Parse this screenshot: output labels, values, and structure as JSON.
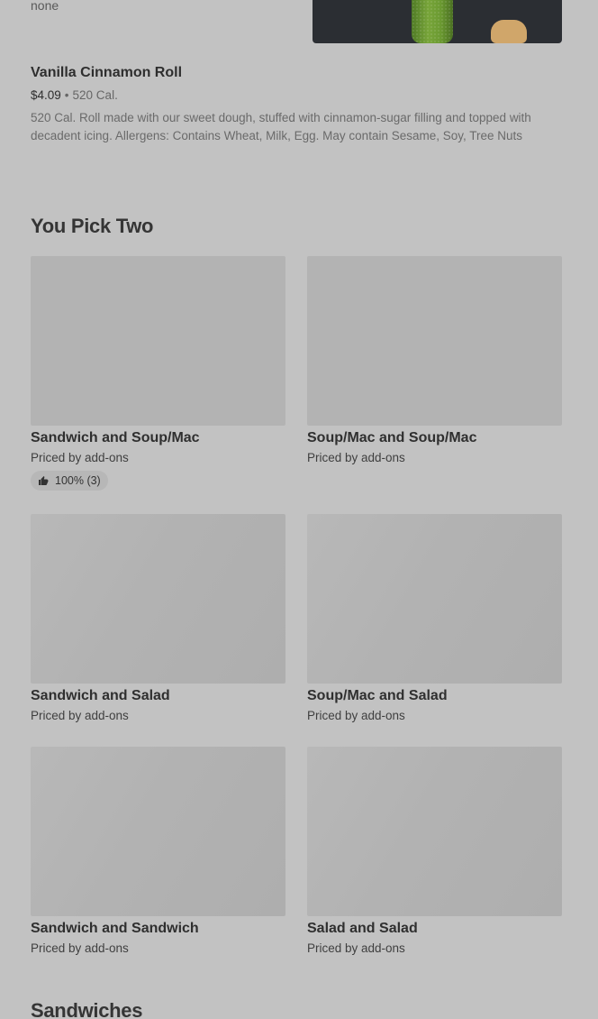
{
  "top_item": {
    "label": "none"
  },
  "menu_item": {
    "title": "Vanilla Cinnamon Roll",
    "price": "$4.09",
    "separator": "•",
    "calories": "520 Cal.",
    "description": "520 Cal. Roll made with our sweet dough, stuffed with cinnamon-sugar filling and topped with decadent icing. Allergens: Contains Wheat, Milk, Egg. May contain Sesame, Soy, Tree Nuts"
  },
  "sections": {
    "you_pick_two": {
      "title": "You Pick Two",
      "cards": [
        {
          "name": "Sandwich and Soup/Mac",
          "sub": "Priced by add-ons",
          "rating": "100% (3)"
        },
        {
          "name": "Soup/Mac and Soup/Mac",
          "sub": "Priced by add-ons"
        },
        {
          "name": "Sandwich and Salad",
          "sub": "Priced by add-ons"
        },
        {
          "name": "Soup/Mac and Salad",
          "sub": "Priced by add-ons"
        },
        {
          "name": "Sandwich and Sandwich",
          "sub": "Priced by add-ons"
        },
        {
          "name": "Salad and Salad",
          "sub": "Priced by add-ons"
        }
      ]
    },
    "sandwiches": {
      "title": "Sandwiches"
    }
  },
  "icons": {
    "rating": "thumbs-up-icon"
  }
}
